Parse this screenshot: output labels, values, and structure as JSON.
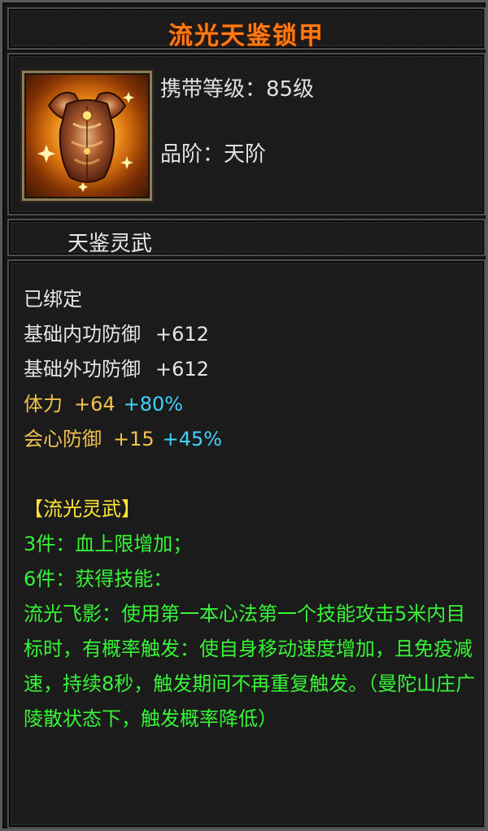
{
  "item": {
    "name": "流光天鉴锁甲",
    "icon": "golden-chest-armor-icon",
    "level_label": "携带等级：",
    "level_value": "85级",
    "grade_label": "品阶：",
    "grade_value": "天阶",
    "set_name": "天鉴灵武"
  },
  "attributes": {
    "bound": "已绑定",
    "base": [
      {
        "label": "基础内功防御",
        "value": "+612"
      },
      {
        "label": "基础外功防御",
        "value": "+612"
      }
    ],
    "extra": [
      {
        "label": "体力",
        "value": "+64",
        "percent": "+80%"
      },
      {
        "label": "会心防御",
        "value": "+15",
        "percent": "+45%"
      }
    ]
  },
  "set_bonus": {
    "title": "【流光灵武】",
    "piece3": "3件：血上限增加；",
    "piece6": "6件：获得技能：",
    "skill_desc": "流光飞影：使用第一本心法第一个技能攻击5米内目标时，有概率触发：使自身移动速度增加，且免疫减速，持续8秒，触发期间不再重复触发。（曼陀山庄广陵散状态下，触发概率降低）"
  },
  "colors": {
    "title": "#ff7a12",
    "extra_attr": "#f2c14e",
    "percent": "#3fd2ff",
    "set_title": "#ffe43a",
    "set_text": "#37f437"
  }
}
